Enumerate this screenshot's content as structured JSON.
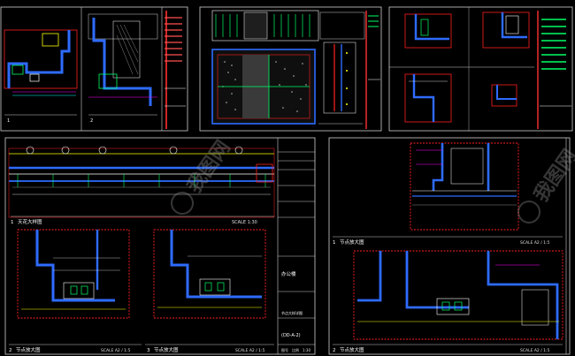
{
  "sheet_tl": {
    "label_a": "1",
    "label_b": "2"
  },
  "sheet_bl": {
    "title_main": "天花大样图",
    "title_main_num": "1",
    "scale_main": "SCALE  1:30",
    "title_node1": "节点放大图",
    "title_node1_num": "2",
    "scale_node1": "SCALE  A2 / 1:5",
    "title_node2": "节点放大图",
    "title_node2_num": "3",
    "scale_node2": "SCALE  A2 / 1:5",
    "project": "办公楼",
    "drawing_no": "(DD-A-2)",
    "sheet_label": "节点大样详图",
    "footer_a": "图号",
    "footer_b": "比例",
    "footer_c": "1:30"
  },
  "sheet_br": {
    "title_1": "节点放大图",
    "title_1_num": "1",
    "scale_1": "SCALE  A2 / 1:5",
    "title_2": "节点放大图",
    "title_2_num": "2",
    "scale_2": "SCALE  A2 / 1:5"
  },
  "watermark": "我图网"
}
